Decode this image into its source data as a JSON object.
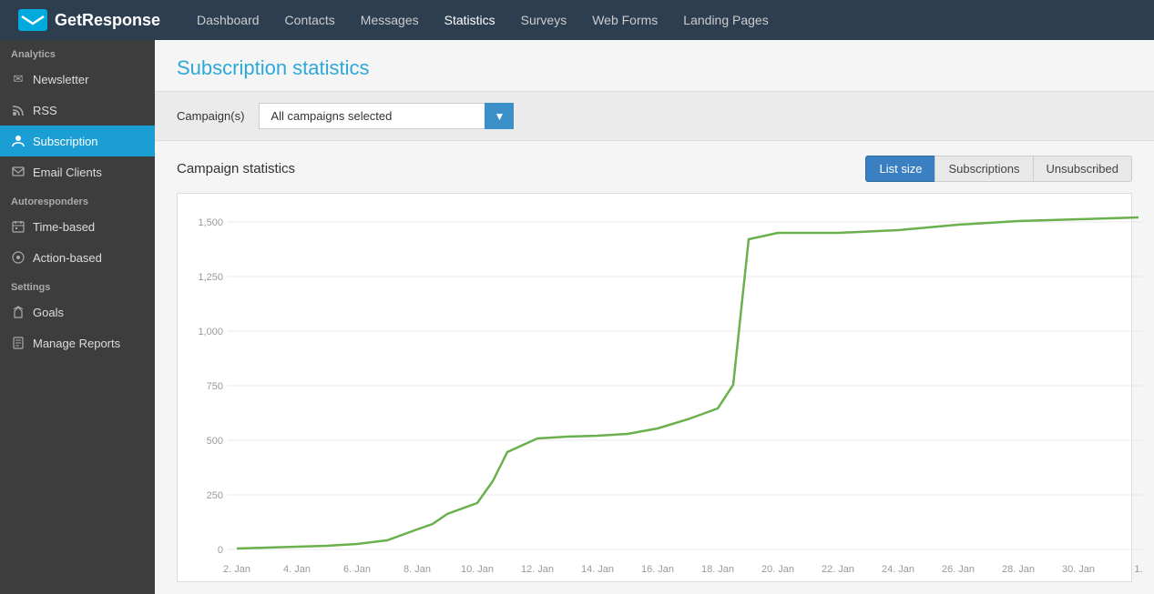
{
  "app": {
    "logo_text": "GetResponse"
  },
  "top_nav": {
    "links": [
      {
        "label": "Dashboard",
        "active": false
      },
      {
        "label": "Contacts",
        "active": false
      },
      {
        "label": "Messages",
        "active": false
      },
      {
        "label": "Statistics",
        "active": true
      },
      {
        "label": "Surveys",
        "active": false
      },
      {
        "label": "Web Forms",
        "active": false
      },
      {
        "label": "Landing Pages",
        "active": false
      }
    ]
  },
  "sidebar": {
    "analytics_label": "Analytics",
    "items_analytics": [
      {
        "id": "newsletter",
        "label": "Newsletter",
        "icon": "✉"
      },
      {
        "id": "rss",
        "label": "RSS",
        "icon": "◎"
      },
      {
        "id": "subscription",
        "label": "Subscription",
        "icon": "👤",
        "active": true
      },
      {
        "id": "email-clients",
        "label": "Email Clients",
        "icon": "🖥"
      }
    ],
    "autoresponders_label": "Autoresponders",
    "items_autoresponders": [
      {
        "id": "time-based",
        "label": "Time-based",
        "icon": "📅"
      },
      {
        "id": "action-based",
        "label": "Action-based",
        "icon": "⚙"
      }
    ],
    "settings_label": "Settings",
    "items_settings": [
      {
        "id": "goals",
        "label": "Goals",
        "icon": "🏆"
      },
      {
        "id": "manage-reports",
        "label": "Manage Reports",
        "icon": "📄"
      }
    ]
  },
  "page": {
    "title": "Subscription statistics",
    "filter_label": "Campaign(s)",
    "filter_value": "All campaigns selected",
    "chart_title": "Campaign statistics",
    "tabs": [
      {
        "label": "List size",
        "active": true
      },
      {
        "label": "Subscriptions",
        "active": false
      },
      {
        "label": "Unsubscribed",
        "active": false
      }
    ]
  },
  "chart": {
    "y_labels": [
      "1,500",
      "1,250",
      "1,000",
      "750",
      "500",
      "250",
      "0"
    ],
    "x_labels": [
      "2. Jan",
      "4. Jan",
      "6. Jan",
      "8. Jan",
      "10. Jan",
      "12. Jan",
      "14. Jan",
      "16. Jan",
      "18. Jan",
      "20. Jan",
      "22. Jan",
      "24. Jan",
      "26. Jan",
      "28. Jan",
      "30. Jan",
      "1."
    ]
  }
}
